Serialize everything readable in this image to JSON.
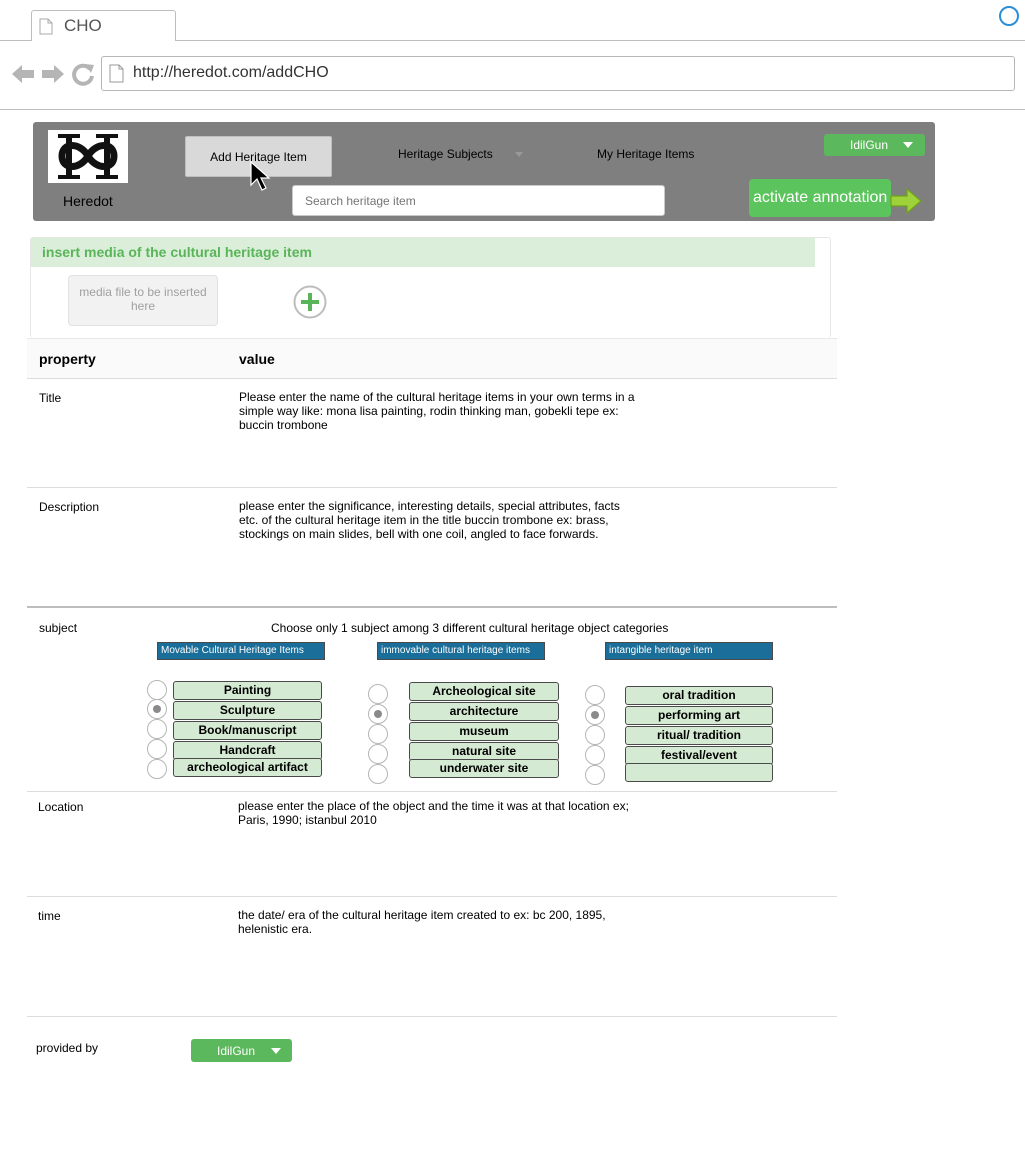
{
  "browser": {
    "tab_title": "CHO",
    "url": "http://heredot.com/addCHO"
  },
  "header": {
    "brand": "Heredot",
    "add_item_label": "Add Heritage Item",
    "subjects_label": "Heritage Subjects",
    "my_items_label": "My Heritage Items",
    "search_placeholder": "Search heritage item",
    "user_label": "IdilGun",
    "annotation_label": "activate annotation"
  },
  "media": {
    "title": "insert media of the cultural heritage item",
    "dropzone_text": "media file to be inserted here"
  },
  "table": {
    "col_property": "property",
    "col_value": "value",
    "rows": {
      "title": {
        "label": "Title",
        "value": "Please enter the name of the cultural heritage items in your own terms in a simple way like: mona lisa painting, rodin thinking man, gobekli tepe ex: buccin trombone"
      },
      "description": {
        "label": "Description",
        "value": "please enter the significance, interesting details, special attributes, facts  etc. of the cultural heritage item in the title buccin trombone ex: brass, stockings on main slides, bell with one coil, angled to face forwards."
      },
      "subject": {
        "label": "subject",
        "instruction": "Choose only 1 subject among 3 different cultural heritage object categories"
      },
      "location": {
        "label": "Location",
        "value": "please enter the place of the object and the time it was at that location ex; Paris, 1990; istanbul 2010"
      },
      "time": {
        "label": "time",
        "value": "the date/ era of the cultural heritage item created to ex: bc 200, 1895, helenistic era."
      },
      "provided_by": {
        "label": "provided by",
        "user": "IdilGun"
      }
    }
  },
  "categories": [
    {
      "name": "Movable Cultural Heritage Items",
      "options": [
        "Painting",
        "Sculpture",
        "Book/manuscript",
        "Handcraft",
        "archeological artifact"
      ],
      "selected_index": 1
    },
    {
      "name": "immovable cultural heritage items",
      "options": [
        "Archeological site",
        "architecture",
        "museum",
        "natural site",
        "underwater site"
      ],
      "selected_index": 1
    },
    {
      "name": "intangible heritage item",
      "options": [
        "oral tradition",
        "performing art",
        "ritual/ tradition",
        "festival/event",
        ""
      ],
      "selected_index": 1
    }
  ],
  "colors": {
    "header_bg": "#7f7f7f",
    "accent_green": "#5cb85c",
    "category_blue": "#1a6e99",
    "option_bg": "#d5ead3"
  }
}
